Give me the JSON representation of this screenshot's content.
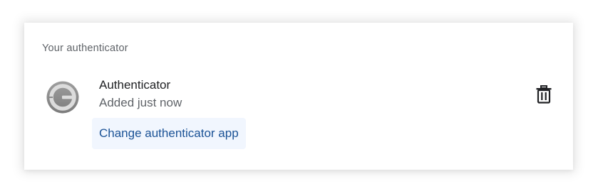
{
  "section": {
    "title": "Your authenticator"
  },
  "authenticator": {
    "name": "Authenticator",
    "status": "Added just now",
    "logo_icon": "google-authenticator-logo-icon",
    "delete_icon": "trash-icon",
    "change_label": "Change authenticator app"
  },
  "colors": {
    "link_blue": "#1a5296",
    "button_bg": "#f1f6fe",
    "secondary_text": "#5f6368",
    "primary_text": "#202124"
  }
}
